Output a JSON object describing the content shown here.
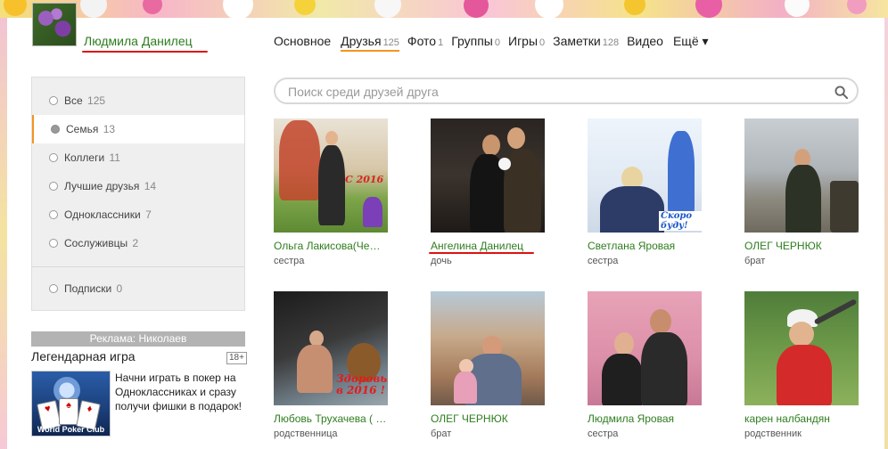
{
  "profile": {
    "name": "Людмила Данилец"
  },
  "nav": [
    {
      "label": "Основное",
      "count": "",
      "active": false
    },
    {
      "label": "Друзья",
      "count": "125",
      "active": true
    },
    {
      "label": "Фото",
      "count": "1",
      "active": false
    },
    {
      "label": "Группы",
      "count": "0",
      "active": false
    },
    {
      "label": "Игры",
      "count": "0",
      "active": false
    },
    {
      "label": "Заметки",
      "count": "128",
      "active": false
    },
    {
      "label": "Видео",
      "count": "",
      "active": false
    },
    {
      "label": "Ещё ▾",
      "count": "",
      "active": false
    }
  ],
  "filters": [
    {
      "label": "Все",
      "count": "125"
    },
    {
      "label": "Семья",
      "count": "13",
      "selected": true
    },
    {
      "label": "Коллеги",
      "count": "11"
    },
    {
      "label": "Лучшие друзья",
      "count": "14"
    },
    {
      "label": "Одноклассники",
      "count": "7"
    },
    {
      "label": "Сослуживцы",
      "count": "2"
    }
  ],
  "subscriptions": {
    "label": "Подписки",
    "count": "0"
  },
  "ad": {
    "header": "Реклама: Николаев",
    "title": "Легендарная игра",
    "age": "18+",
    "text": "Начни играть в покер на Одноклассниках и сразу получи фишки в подарок!",
    "brand": "World Poker Club"
  },
  "search": {
    "placeholder": "Поиск среди друзей друга"
  },
  "friends": [
    {
      "name": "Ольга Лакисова(Че…",
      "relation": "сестра",
      "photo_text": "С 2016"
    },
    {
      "name": "Ангелина Данилец",
      "relation": "дочь"
    },
    {
      "name": "Светлана Яровая",
      "relation": "сестра",
      "photo_text": "Скоро буду!"
    },
    {
      "name": "ОЛЕГ ЧЕРНЮК",
      "relation": "брат"
    },
    {
      "name": "Любовь Трухачева ( …",
      "relation": "родственница",
      "photo_text": "Здоровья в 2016 !"
    },
    {
      "name": "ОЛЕГ ЧЕРНЮК",
      "relation": "брат"
    },
    {
      "name": "Людмила Яровая",
      "relation": "сестра"
    },
    {
      "name": "карен налбандян",
      "relation": "родственник"
    }
  ],
  "colors": {
    "accent": "#f59420",
    "link": "#2e7d1e",
    "highlight": "#dd1111"
  }
}
